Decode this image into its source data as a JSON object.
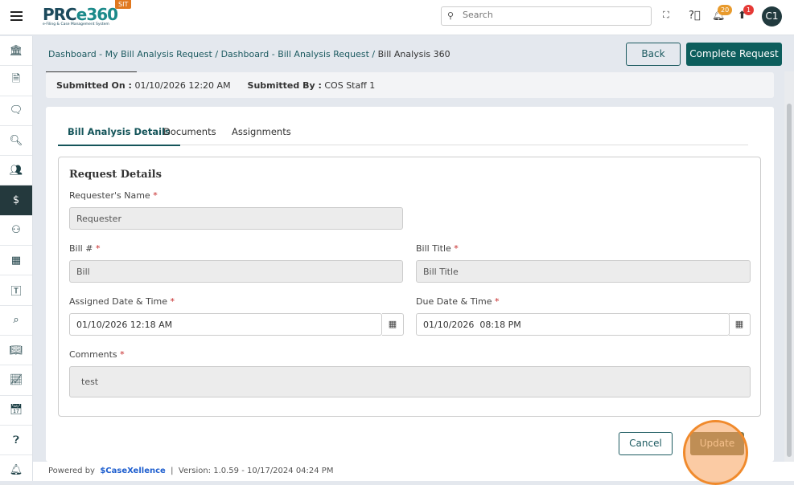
{
  "header": {
    "logo": "PRCe360",
    "logo_sub": "e-Filing & Case Management System",
    "env_badge": "SIT",
    "search_placeholder": "Search",
    "notifications_count": "20",
    "uploads_count": "1",
    "avatar": "C1"
  },
  "sidebar": {
    "items": [
      "bank-icon",
      "document-icon",
      "comment-icon",
      "file-search-icon",
      "users-icon",
      "bill-dollar-icon",
      "meeting-icon",
      "building-icon",
      "text-box-icon",
      "scan-search-icon",
      "book-icon",
      "chart-icon",
      "calendar-icon",
      "help-box-icon",
      "alarm-icon"
    ],
    "active": 5
  },
  "breadcrumb": [
    "Dashboard - My Bill Analysis Request",
    "Dashboard - Bill Analysis Request",
    "Bill Analysis 360"
  ],
  "actions": {
    "back": "Back",
    "complete": "Complete Request"
  },
  "submitted": {
    "on_label": "Submitted On :",
    "on_value": "01/10/2026 12:20 AM",
    "by_label": "Submitted By :",
    "by_value": "COS Staff 1"
  },
  "tabs": [
    "Bill Analysis Details",
    "Documents",
    "Assignments"
  ],
  "form": {
    "title": "Request Details",
    "requester_label": "Requester's Name",
    "requester_value": "Requester",
    "bill_label": "Bill #",
    "bill_value": "Bill",
    "bill_title_label": "Bill Title",
    "bill_title_value": "Bill Title",
    "assigned_label": "Assigned Date & Time",
    "assigned_value": "01/10/2026 12:18 AM",
    "due_label": "Due Date & Time",
    "due_value": "01/10/2026  08:18 PM",
    "comments_label": "Comments",
    "comments_value": "test",
    "required": "*"
  },
  "buttons": {
    "cancel": "Cancel",
    "update": "Update"
  },
  "footer": {
    "powered": "Powered by",
    "brand": "CaseXellence",
    "sep": "|",
    "version": "Version: 1.0.59 - 10/17/2024 04:24 PM"
  }
}
